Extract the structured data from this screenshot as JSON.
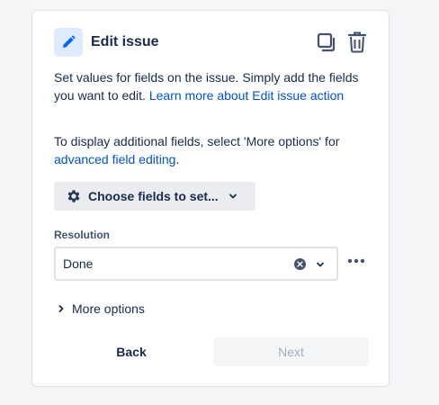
{
  "header": {
    "title": "Edit issue",
    "icon": "pencil-icon",
    "actions": [
      "duplicate-icon",
      "trash-icon"
    ]
  },
  "description": {
    "text1": "Set values for fields on the issue. Simply add the fields you want to edit. ",
    "link1": "Learn more about Edit issue action",
    "text2": "To display additional fields, select 'More options' for ",
    "link2": "advanced field editing",
    "text2_end": "."
  },
  "choose_fields": {
    "label": "Choose fields to set...",
    "icon": "gear-icon"
  },
  "resolution": {
    "label": "Resolution",
    "value": "Done"
  },
  "more_options": {
    "label": "More options"
  },
  "footer": {
    "back_label": "Back",
    "next_label": "Next"
  },
  "colors": {
    "accent": "#0052cc",
    "badge_bg": "#deebff",
    "button_bg": "#ebecf0",
    "text": "#172b4d",
    "disabled_text": "#a5adba"
  }
}
